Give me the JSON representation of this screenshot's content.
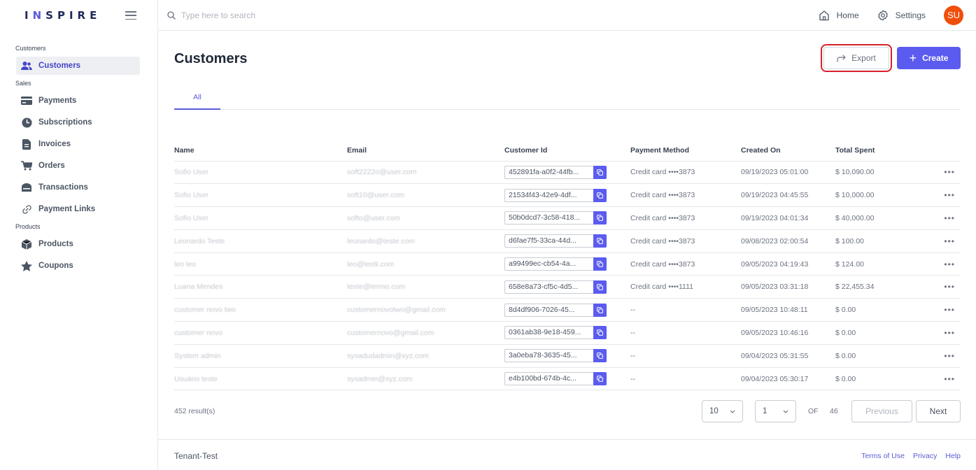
{
  "brand": {
    "logo": "INSPIRE"
  },
  "sidebar": {
    "sections": [
      {
        "label": "Customers"
      },
      {
        "label": "Sales"
      },
      {
        "label": "Products"
      }
    ],
    "items": [
      {
        "label": "Customers",
        "icon": "users-icon"
      },
      {
        "label": "Payments",
        "icon": "credit-card-icon"
      },
      {
        "label": "Subscriptions",
        "icon": "pie-chart-icon"
      },
      {
        "label": "Invoices",
        "icon": "document-icon"
      },
      {
        "label": "Orders",
        "icon": "cart-icon"
      },
      {
        "label": "Transactions",
        "icon": "bank-icon"
      },
      {
        "label": "Payment Links",
        "icon": "link-icon"
      },
      {
        "label": "Products",
        "icon": "cube-icon"
      },
      {
        "label": "Coupons",
        "icon": "star-icon"
      }
    ]
  },
  "topbar": {
    "search_placeholder": "Type here to search",
    "home_label": "Home",
    "settings_label": "Settings",
    "avatar_initials": "SU"
  },
  "page": {
    "title": "Customers",
    "export_label": "Export",
    "create_label": "Create",
    "tab_all": "All"
  },
  "table": {
    "headers": [
      "Name",
      "Email",
      "Customer Id",
      "Payment Method",
      "Created On",
      "Total Spent"
    ],
    "rows": [
      {
        "name": "Sofio User",
        "email": "soft2222o@user.com",
        "id": "452891fa-a0f2-44fb...",
        "method": "Credit card ••••3873",
        "created": "09/19/2023 05:01:00",
        "total": "$ 10,090.00"
      },
      {
        "name": "Sofio User",
        "email": "soft10@user.com",
        "id": "21534f43-42e9-4df...",
        "method": "Credit card ••••3873",
        "created": "09/19/2023 04:45:55",
        "total": "$ 10,000.00"
      },
      {
        "name": "Sofio User",
        "email": "softo@user.com",
        "id": "50b0dcd7-3c58-418...",
        "method": "Credit card ••••3873",
        "created": "09/19/2023 04:01:34",
        "total": "$ 40,000.00"
      },
      {
        "name": "Leonardo Teste",
        "email": "leonardo@teste.com",
        "id": "d6fae7f5-33ca-44d...",
        "method": "Credit card ••••3873",
        "created": "09/08/2023 02:00:54",
        "total": "$ 100.00"
      },
      {
        "name": "leo leo",
        "email": "leo@leo9.com",
        "id": "a99499ec-cb54-4a...",
        "method": "Credit card ••••3873",
        "created": "09/05/2023 04:19:43",
        "total": "$ 124.00"
      },
      {
        "name": "Luana Mendes",
        "email": "teste@termo.com",
        "id": "658e8a73-cf5c-4d5...",
        "method": "Credit card ••••1111",
        "created": "09/05/2023 03:31:18",
        "total": "$ 22,455.34"
      },
      {
        "name": "customer novo two",
        "email": "customernovotwo@gmail.com",
        "id": "8d4df906-7026-45...",
        "method": "--",
        "created": "09/05/2023 10:48:11",
        "total": "$ 0.00"
      },
      {
        "name": "customer novo",
        "email": "customernovo@gmail.com",
        "id": "0361ab38-9e18-459...",
        "method": "--",
        "created": "09/05/2023 10:46:16",
        "total": "$ 0.00"
      },
      {
        "name": "System admin",
        "email": "sysadudadmin@xyz.com",
        "id": "3a0eba78-3635-45...",
        "method": "--",
        "created": "09/04/2023 05:31:55",
        "total": "$ 0.00"
      },
      {
        "name": "Usuário teste",
        "email": "sysadmin@xyz.com",
        "id": "e4b100bd-674b-4c...",
        "method": "--",
        "created": "09/04/2023 05:30:17",
        "total": "$ 0.00"
      }
    ]
  },
  "pagination": {
    "results": "452 result(s)",
    "page_size": "10",
    "current_page": "1",
    "of_label": "OF",
    "total_pages": "46",
    "previous_label": "Previous",
    "next_label": "Next"
  },
  "footer": {
    "tenant": "Tenant-Test",
    "terms": "Terms of Use",
    "privacy": "Privacy",
    "help": "Help"
  },
  "colors": {
    "accent": "#5b5bf0",
    "avatar": "#f04e0b",
    "highlight": "#d9212c"
  }
}
